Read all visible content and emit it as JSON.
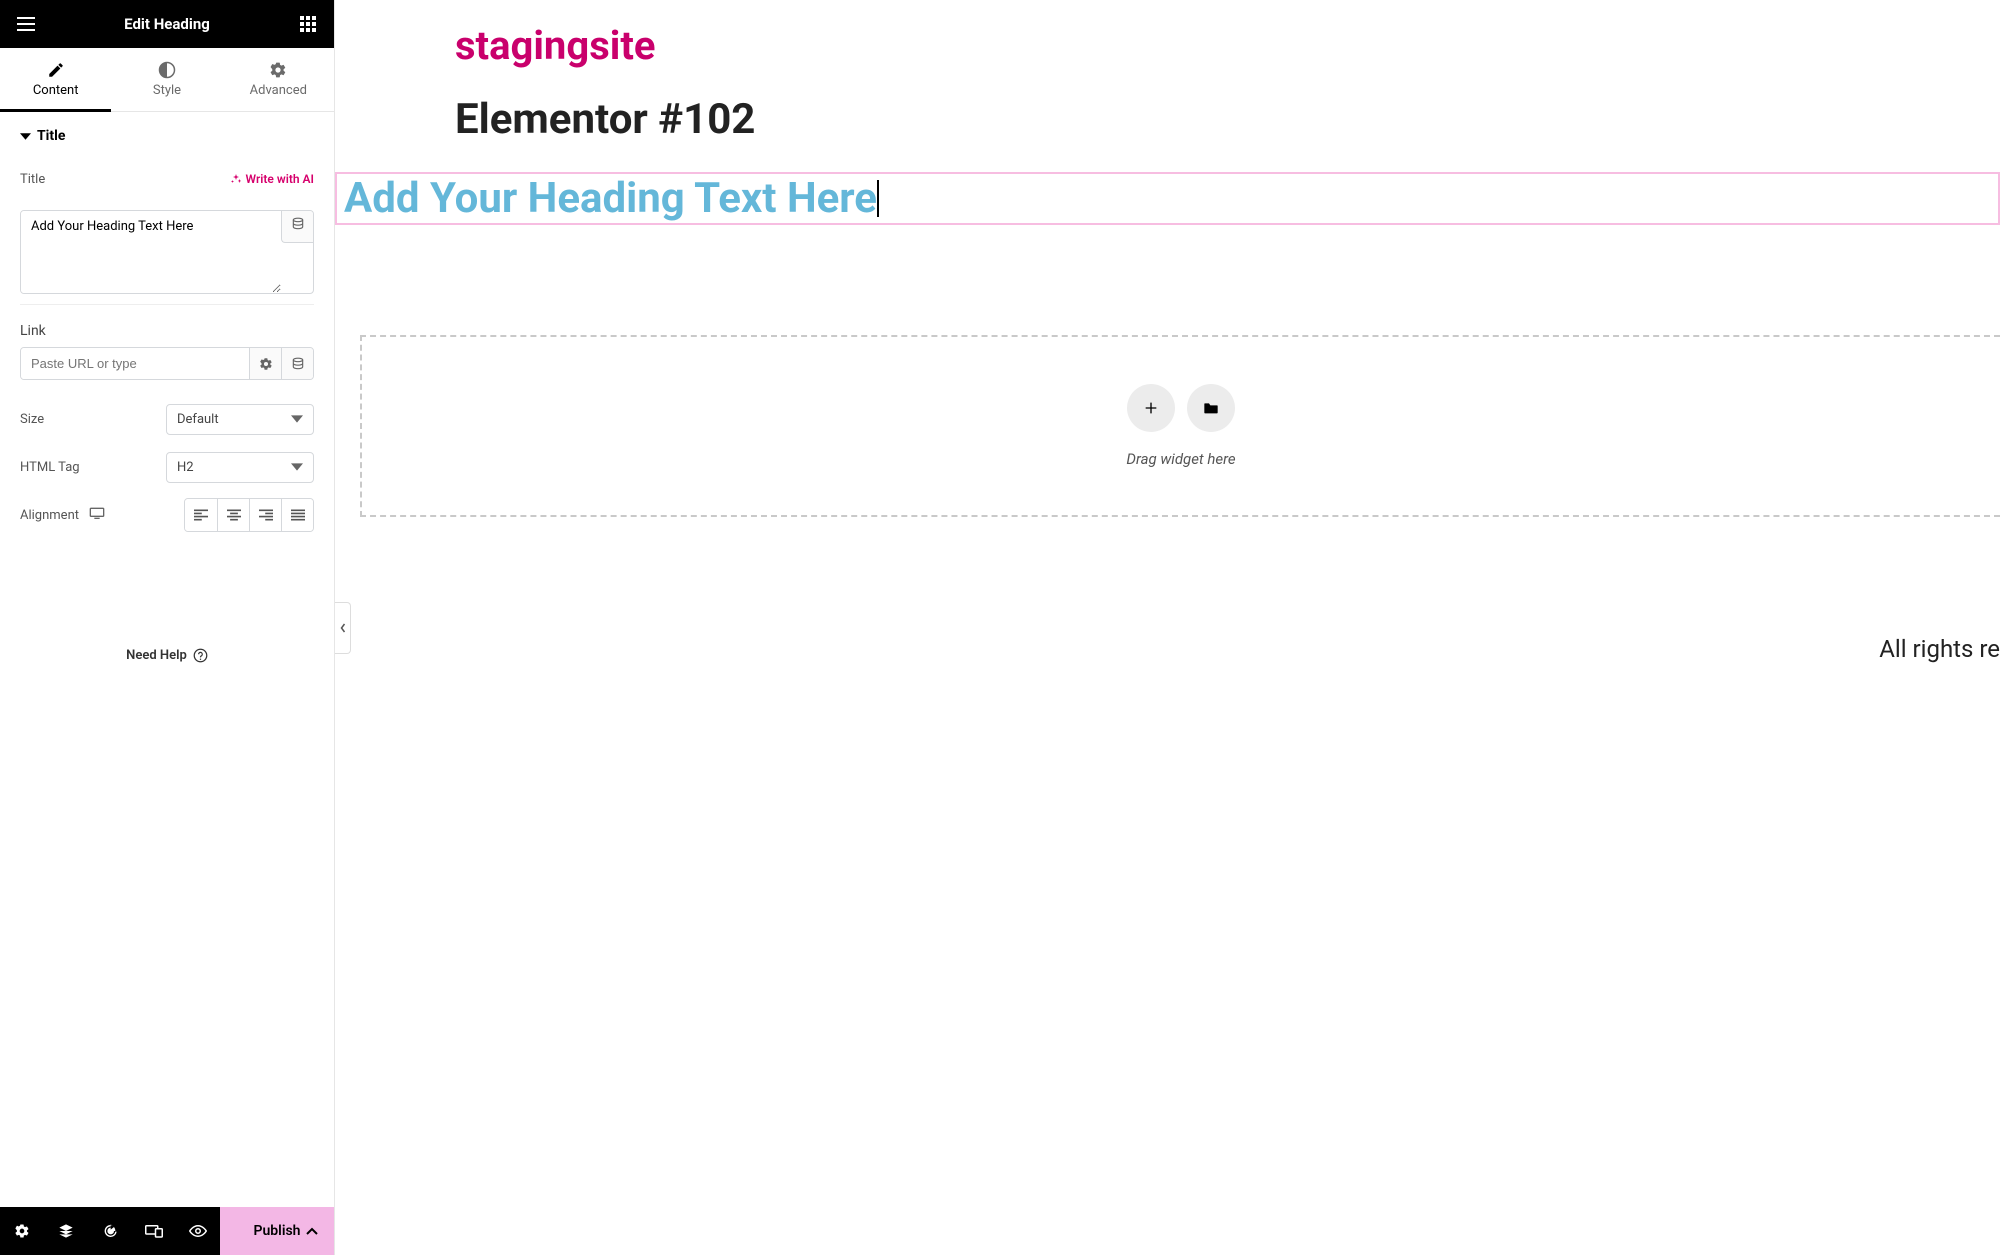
{
  "header": {
    "title": "Edit Heading"
  },
  "tabs": {
    "content": "Content",
    "style": "Style",
    "advanced": "Advanced"
  },
  "section": {
    "title_heading": "Title",
    "fields": {
      "title_label": "Title",
      "ai_link": "Write with AI",
      "title_value": "Add Your Heading Text Here",
      "link_label": "Link",
      "link_placeholder": "Paste URL or type",
      "size_label": "Size",
      "size_value": "Default",
      "html_tag_label": "HTML Tag",
      "html_tag_value": "H2",
      "alignment_label": "Alignment"
    }
  },
  "help": {
    "label": "Need Help"
  },
  "footer": {
    "publish": "Publish"
  },
  "canvas": {
    "site_title": "stagingsite",
    "page_heading": "Elementor #102",
    "heading_text": "Add Your Heading Text Here",
    "drag_text": "Drag widget here",
    "footer_text": "All rights re"
  }
}
